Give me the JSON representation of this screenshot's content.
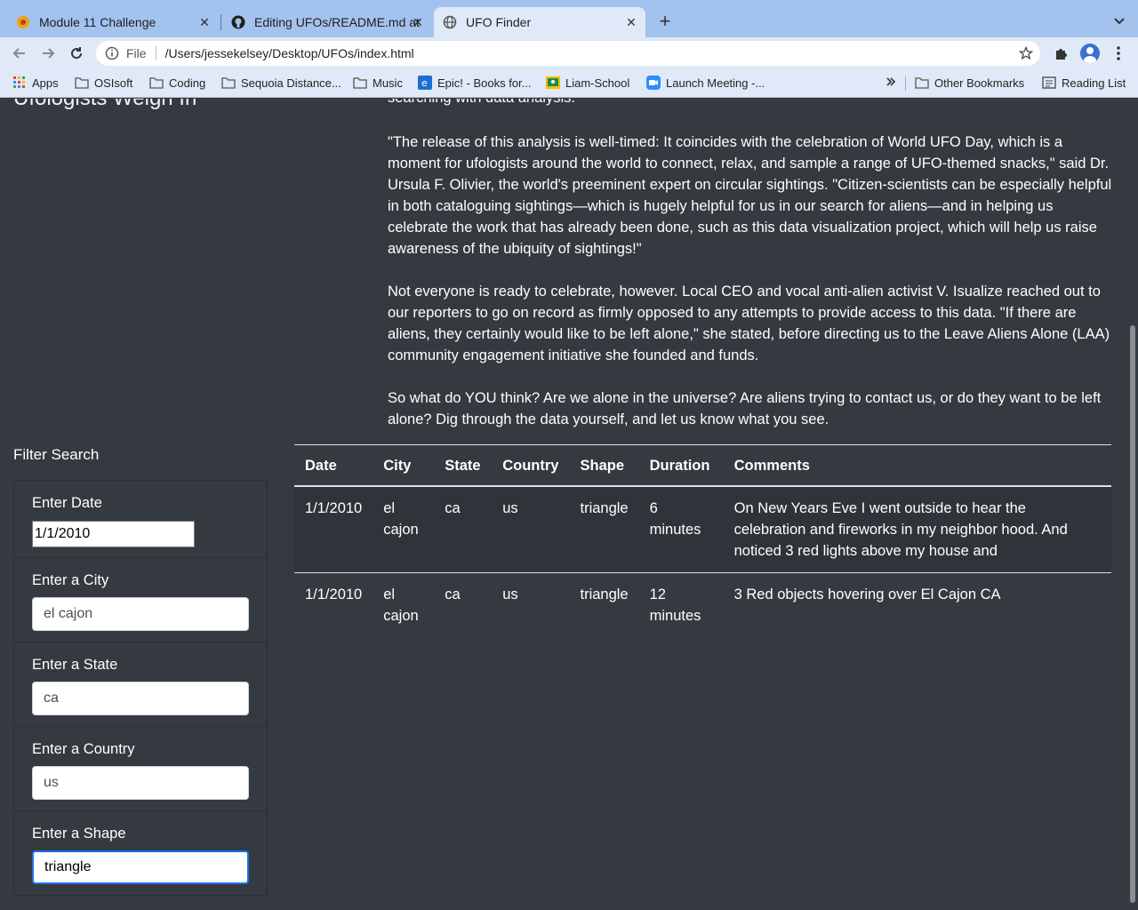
{
  "tabs": [
    {
      "title": "Module 11 Challenge",
      "icon": "canvas-icon"
    },
    {
      "title": "Editing UFOs/README.md at m",
      "icon": "github-icon"
    },
    {
      "title": "UFO Finder",
      "icon": "globe-icon",
      "active": true
    }
  ],
  "address_bar": {
    "scheme_label": "File",
    "url": "/Users/jessekelsey/Desktop/UFOs/index.html"
  },
  "bookmarks": [
    {
      "label": "Apps",
      "icon": "apps-grid-icon"
    },
    {
      "label": "OSIsoft",
      "icon": "folder-icon"
    },
    {
      "label": "Coding",
      "icon": "folder-icon"
    },
    {
      "label": "Sequoia Distance...",
      "icon": "folder-icon"
    },
    {
      "label": "Music",
      "icon": "folder-icon"
    },
    {
      "label": "Epic! - Books for...",
      "icon": "epic-icon"
    },
    {
      "label": "Liam-School",
      "icon": "classroom-icon"
    },
    {
      "label": "Launch Meeting -...",
      "icon": "zoom-icon"
    },
    {
      "label": "Other Bookmarks",
      "icon": "folder-icon"
    },
    {
      "label": "Reading List",
      "icon": "reading-list-icon"
    }
  ],
  "page": {
    "heading_partial": "Ufologists Weigh In",
    "article": {
      "p1_tail": "searching with data analysis.",
      "p2": "\"The release of this analysis is well-timed: It coincides with the celebration of World UFO Day, which is a moment for ufologists around the world to connect, relax, and sample a range of UFO-themed snacks,\" said Dr. Ursula F. Olivier, the world's preeminent expert on circular sightings. \"Citizen-scientists can be especially helpful in both cataloguing sightings—which is hugely helpful for us in our search for aliens—and in helping us celebrate the work that has already been done, such as this data visualization project, which will help us raise awareness of the ubiquity of sightings!\"",
      "p3": "Not everyone is ready to celebrate, however. Local CEO and vocal anti-alien activist V. Isualize reached out to our reporters to go on record as firmly opposed to any attempts to provide access to this data. \"If there are aliens, they certainly would like to be left alone,\" she stated, before directing us to the Leave Aliens Alone (LAA) community engagement initiative she founded and funds.",
      "p4": "So what do YOU think? Are we alone in the universe? Are aliens trying to contact us, or do they want to be left alone? Dig through the data yourself, and let us know what you see."
    },
    "filter": {
      "title": "Filter Search",
      "date": {
        "label": "Enter Date",
        "value": "1/1/2010"
      },
      "city": {
        "label": "Enter a City",
        "value": "el cajon"
      },
      "state": {
        "label": "Enter a State",
        "value": "ca"
      },
      "country": {
        "label": "Enter a Country",
        "value": "us"
      },
      "shape": {
        "label": "Enter a Shape",
        "value": "triangle"
      }
    },
    "table": {
      "headers": [
        "Date",
        "City",
        "State",
        "Country",
        "Shape",
        "Duration",
        "Comments"
      ],
      "rows": [
        [
          "1/1/2010",
          "el cajon",
          "ca",
          "us",
          "triangle",
          "6 minutes",
          "On New Years Eve I went outside to hear the celebration and fireworks in my neighbor hood. And noticed 3 red lights above my house and"
        ],
        [
          "1/1/2010",
          "el cajon",
          "ca",
          "us",
          "triangle",
          "12 minutes",
          "3 Red objects hovering over El Cajon CA"
        ]
      ]
    }
  },
  "colors": {
    "page_bg": "#343a40",
    "tabstrip_bg": "#a4c2ee",
    "toolbar_bg": "#dfe9f8",
    "focus_ring": "#1a73e8"
  }
}
